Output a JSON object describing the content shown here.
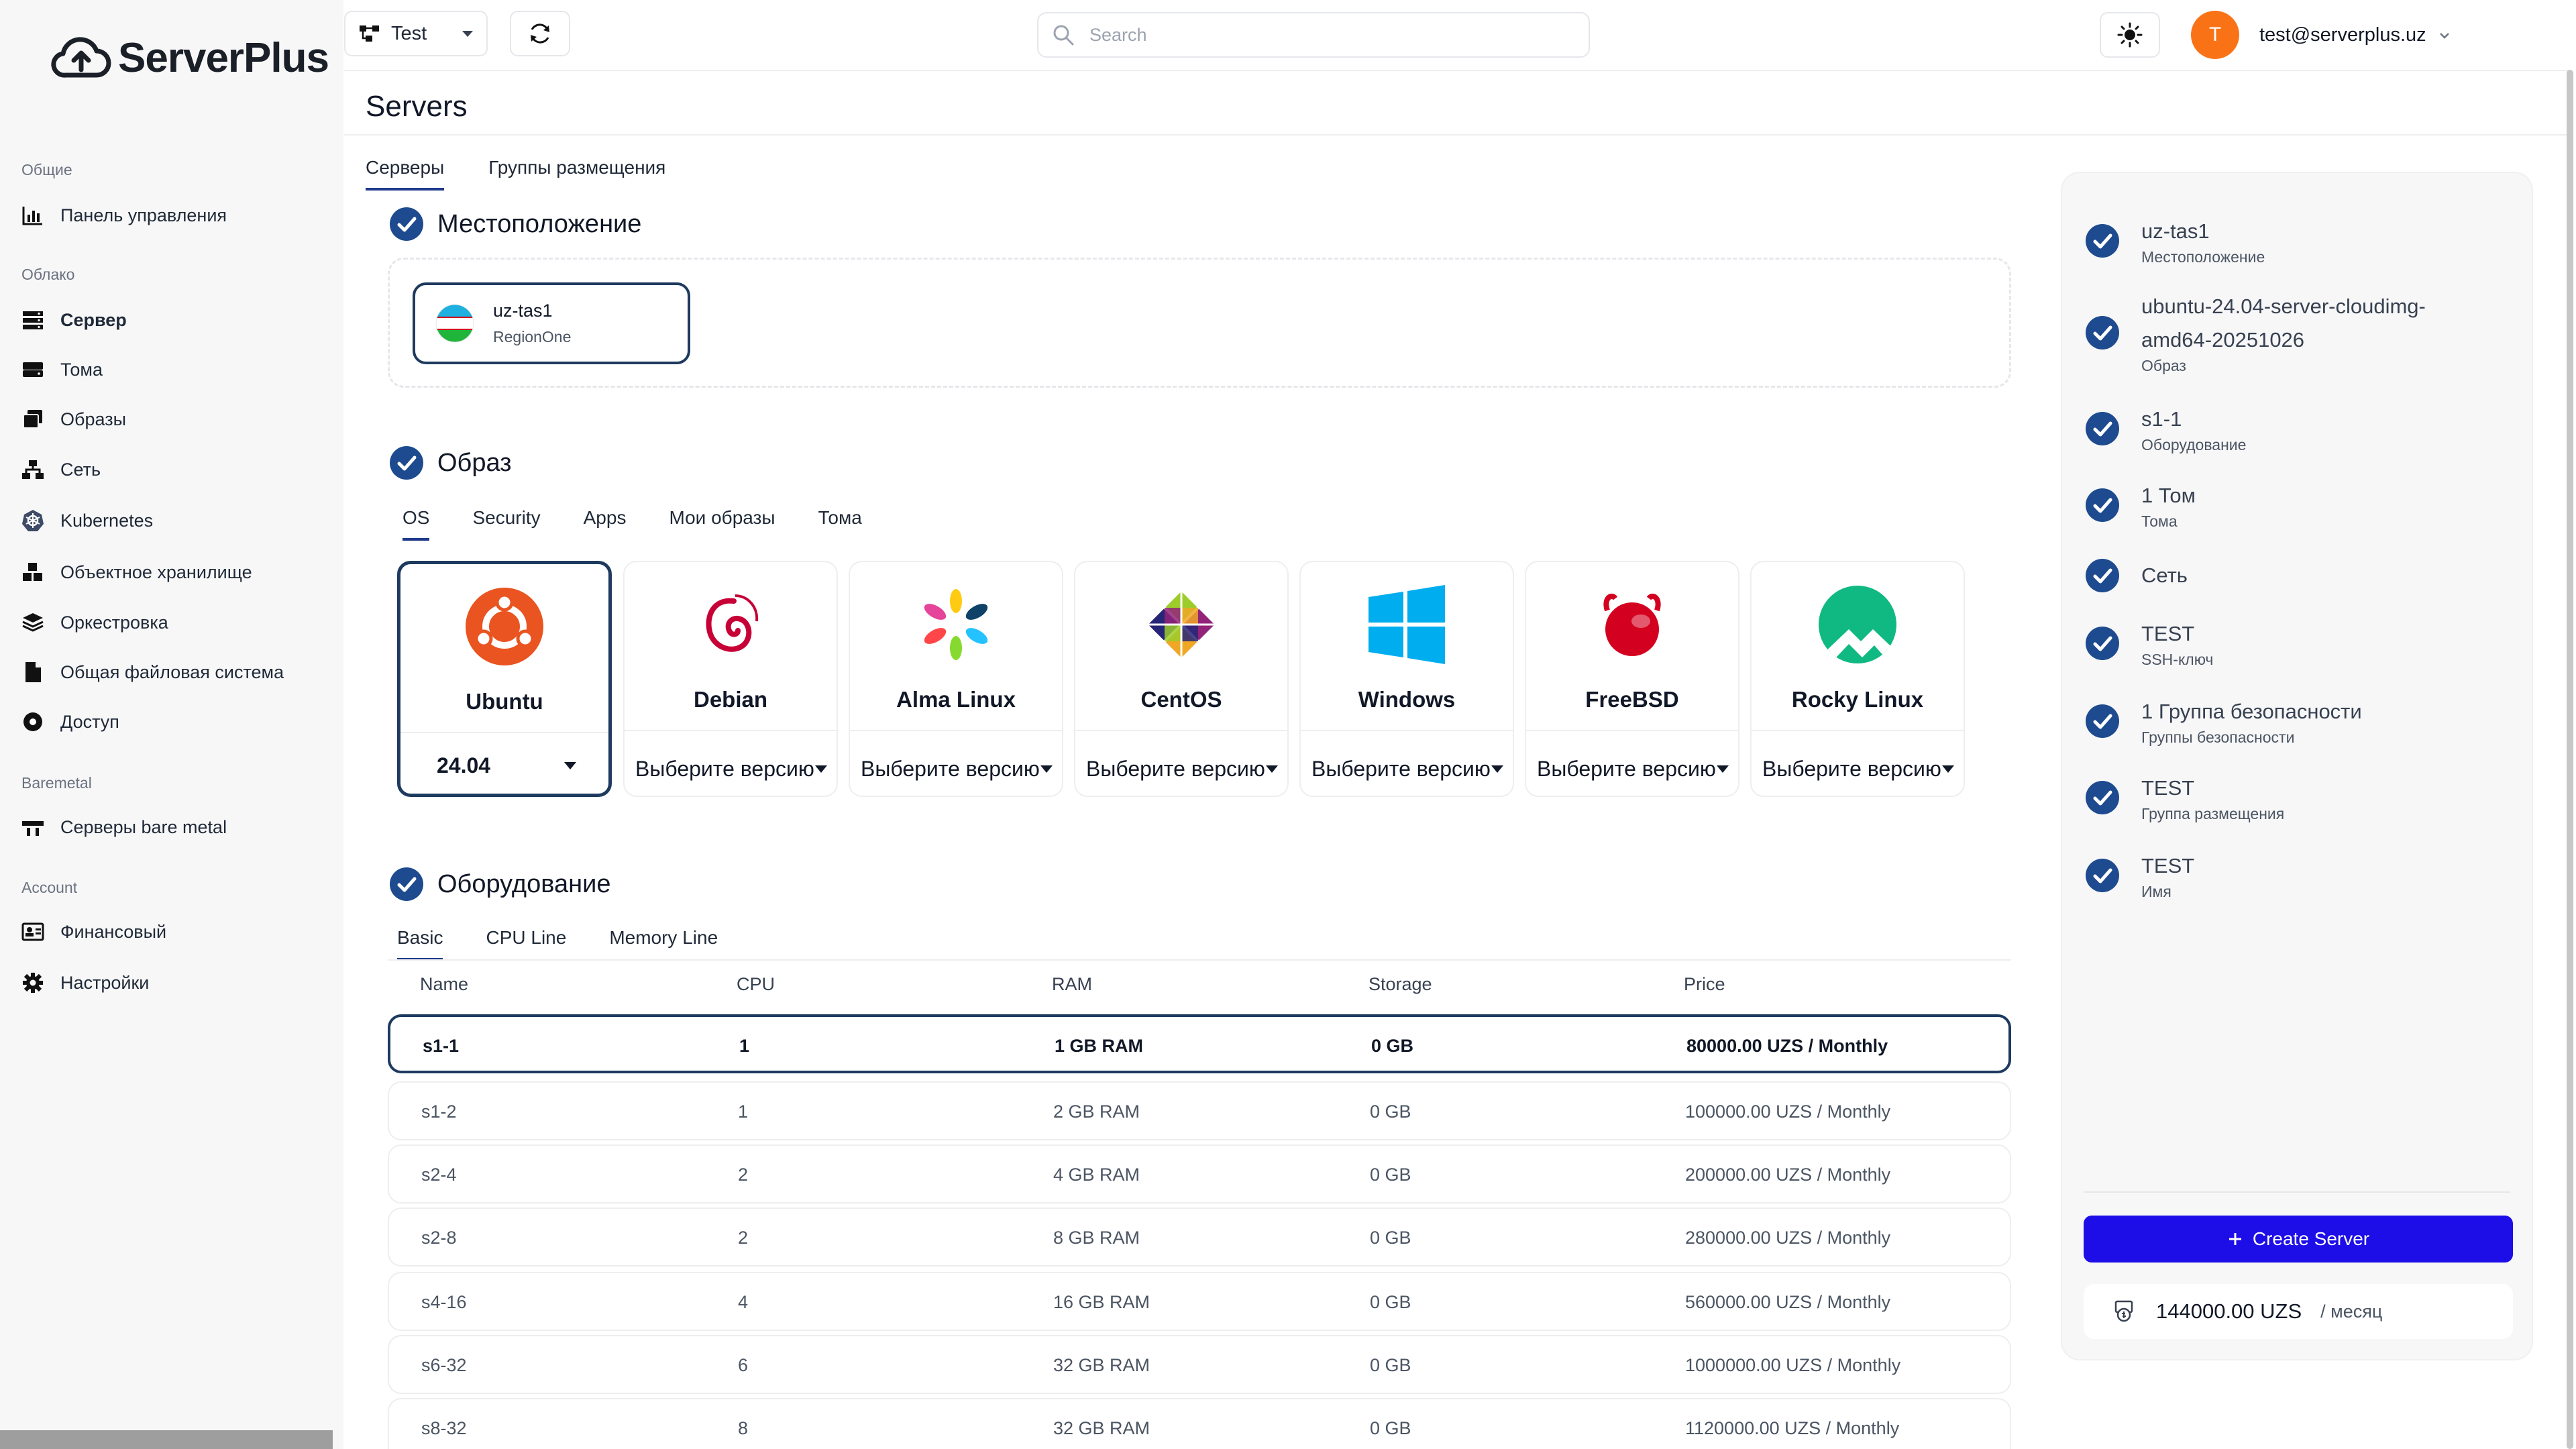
{
  "app": {
    "brand": "ServerPlus"
  },
  "topbar": {
    "project": "Test",
    "search_placeholder": "Search",
    "avatar_letter": "T",
    "user_email": "test@serverplus.uz"
  },
  "sidebar": {
    "groups": [
      {
        "title": "Общие",
        "items": [
          {
            "label": "Панель управления",
            "icon": "chart-icon"
          }
        ]
      },
      {
        "title": "Облако",
        "items": [
          {
            "label": "Сервер",
            "icon": "server-icon",
            "active": true
          },
          {
            "label": "Тома",
            "icon": "drive-icon"
          },
          {
            "label": "Образы",
            "icon": "images-icon"
          },
          {
            "label": "Сеть",
            "icon": "network-icon"
          },
          {
            "label": "Kubernetes",
            "icon": "kubernetes-icon"
          },
          {
            "label": "Объектное хранилище",
            "icon": "cubes-icon"
          },
          {
            "label": "Оркестровка",
            "icon": "layers-icon"
          },
          {
            "label": "Общая файловая система",
            "icon": "file-icon"
          },
          {
            "label": "Доступ",
            "icon": "dot-circle-icon"
          }
        ]
      },
      {
        "title": "Baremetal",
        "items": [
          {
            "label": "Серверы bare metal",
            "icon": "baremetal-icon"
          }
        ]
      },
      {
        "title": "Account",
        "items": [
          {
            "label": "Финансовый",
            "icon": "id-card-icon"
          },
          {
            "label": "Настройки",
            "icon": "gear-icon"
          }
        ]
      }
    ]
  },
  "page": {
    "title": "Servers",
    "tabs": [
      "Серверы",
      "Группы размещения"
    ]
  },
  "location": {
    "section_title": "Местоположение",
    "card": {
      "name": "uz-tas1",
      "region": "RegionOne"
    }
  },
  "image": {
    "section_title": "Образ",
    "tabs": [
      "OS",
      "Security",
      "Apps",
      "Мои образы",
      "Тома"
    ],
    "os": [
      {
        "name": "Ubuntu",
        "version": "24.04",
        "icon": "ubuntu-logo-icon"
      },
      {
        "name": "Debian",
        "version": "Выберите версию",
        "icon": "debian-logo-icon"
      },
      {
        "name": "Alma Linux",
        "version": "Выберите версию",
        "icon": "almalinux-logo-icon"
      },
      {
        "name": "CentOS",
        "version": "Выберите версию",
        "icon": "centos-logo-icon"
      },
      {
        "name": "Windows",
        "version": "Выберите версию",
        "icon": "windows-logo-icon"
      },
      {
        "name": "FreeBSD",
        "version": "Выберите версию",
        "icon": "freebsd-logo-icon"
      },
      {
        "name": "Rocky Linux",
        "version": "Выберите версию",
        "icon": "rockylinux-logo-icon"
      }
    ]
  },
  "hardware": {
    "section_title": "Оборудование",
    "tabs": [
      "Basic",
      "CPU Line",
      "Memory Line"
    ],
    "columns": [
      "Name",
      "CPU",
      "RAM",
      "Storage",
      "Price"
    ],
    "rows": [
      {
        "name": "s1-1",
        "cpu": "1",
        "ram": "1 GB RAM",
        "storage": "0 GB",
        "price": "80000.00 UZS / Monthly",
        "selected": true
      },
      {
        "name": "s1-2",
        "cpu": "1",
        "ram": "2 GB RAM",
        "storage": "0 GB",
        "price": "100000.00 UZS / Monthly"
      },
      {
        "name": "s2-4",
        "cpu": "2",
        "ram": "4 GB RAM",
        "storage": "0 GB",
        "price": "200000.00 UZS / Monthly"
      },
      {
        "name": "s2-8",
        "cpu": "2",
        "ram": "8 GB RAM",
        "storage": "0 GB",
        "price": "280000.00 UZS / Monthly"
      },
      {
        "name": "s4-16",
        "cpu": "4",
        "ram": "16 GB RAM",
        "storage": "0 GB",
        "price": "560000.00 UZS / Monthly"
      },
      {
        "name": "s6-32",
        "cpu": "6",
        "ram": "32 GB RAM",
        "storage": "0 GB",
        "price": "1000000.00 UZS / Monthly"
      },
      {
        "name": "s8-32",
        "cpu": "8",
        "ram": "32 GB RAM",
        "storage": "0 GB",
        "price": "1120000.00 UZS / Monthly"
      }
    ]
  },
  "summary": {
    "items": [
      {
        "lines": [
          "uz-tas1"
        ],
        "sub": "Местоположение"
      },
      {
        "lines": [
          "ubuntu-24.04-server-cloudimg-",
          "amd64-20251026"
        ],
        "sub": "Образ"
      },
      {
        "lines": [
          "s1-1"
        ],
        "sub": "Оборудование"
      },
      {
        "lines": [
          "1 Том"
        ],
        "sub": "Тома"
      },
      {
        "lines": [
          "Сеть"
        ],
        "sub": ""
      },
      {
        "lines": [
          "TEST"
        ],
        "sub": "SSH-ключ"
      },
      {
        "lines": [
          "1 Группа безопасности"
        ],
        "sub": "Группы безопасности"
      },
      {
        "lines": [
          "TEST"
        ],
        "sub": "Группа размещения"
      },
      {
        "lines": [
          "TEST"
        ],
        "sub": "Имя"
      }
    ],
    "create_label": "Create Server",
    "total_value": "144000.00 UZS",
    "total_period": "/ месяц"
  },
  "colors": {
    "accent": "#1e3a5f",
    "check": "#1e4b8f",
    "create_button": "#1d0ee8",
    "avatar": "#f97316"
  }
}
